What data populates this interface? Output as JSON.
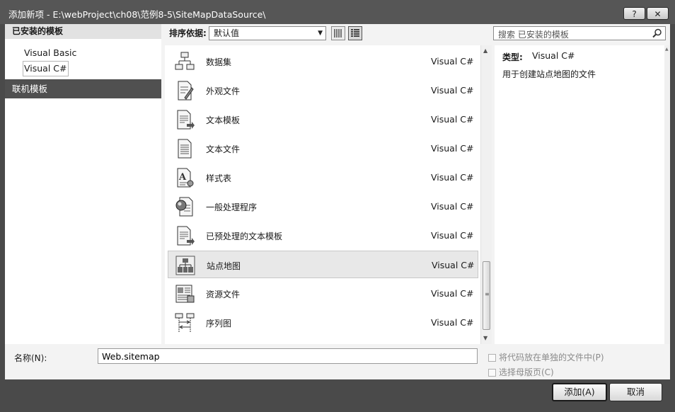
{
  "window": {
    "title": "添加新项 - E:\\webProject\\ch08\\范例8-5\\SiteMapDataSource\\",
    "help_label": "?",
    "close_label": "✕"
  },
  "left_panel": {
    "header": "已安装的模板",
    "items": [
      {
        "label": "Visual Basic",
        "selected": false
      },
      {
        "label": "Visual C#",
        "selected": true
      }
    ],
    "online_label": "联机模板"
  },
  "toolbar": {
    "sort_label": "排序依据:",
    "sort_value": "默认值",
    "search_placeholder": "搜索 已安装的模板"
  },
  "templates": [
    {
      "name": "数据集",
      "lang": "Visual C#",
      "icon": "dataset-icon",
      "selected": false
    },
    {
      "name": "外观文件",
      "lang": "Visual C#",
      "icon": "skin-file-icon",
      "selected": false
    },
    {
      "name": "文本模板",
      "lang": "Visual C#",
      "icon": "text-template-icon",
      "selected": false
    },
    {
      "name": "文本文件",
      "lang": "Visual C#",
      "icon": "text-file-icon",
      "selected": false
    },
    {
      "name": "样式表",
      "lang": "Visual C#",
      "icon": "stylesheet-icon",
      "selected": false
    },
    {
      "name": "一般处理程序",
      "lang": "Visual C#",
      "icon": "generic-handler-icon",
      "selected": false
    },
    {
      "name": "已预处理的文本模板",
      "lang": "Visual C#",
      "icon": "preprocessed-template-icon",
      "selected": false
    },
    {
      "name": "站点地图",
      "lang": "Visual C#",
      "icon": "sitemap-icon",
      "selected": true
    },
    {
      "name": "资源文件",
      "lang": "Visual C#",
      "icon": "resource-file-icon",
      "selected": false
    },
    {
      "name": "序列图",
      "lang": "Visual C#",
      "icon": "sequence-diagram-icon",
      "selected": false
    }
  ],
  "details": {
    "type_label": "类型:",
    "type_value": "Visual C#",
    "description": "用于创建站点地图的文件"
  },
  "form": {
    "name_label": "名称(N):",
    "name_value": "Web.sitemap",
    "checkbox_separate": "将代码放在单独的文件中(P)",
    "checkbox_master": "选择母版页(C)"
  },
  "buttons": {
    "add": "添加(A)",
    "cancel": "取消"
  }
}
